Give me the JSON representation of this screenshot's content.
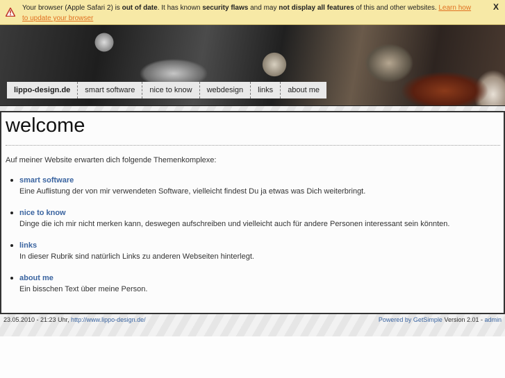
{
  "warning": {
    "text_1": "Your browser (Apple Safari 2) is ",
    "bold_1": "out of date",
    "text_2": ". It has known ",
    "bold_2": "security flaws",
    "text_3": " and may ",
    "bold_3": "not display all features",
    "text_4": " of this and other websites. ",
    "link": "Learn how to update your browser",
    "close_label": "X",
    "icon": "warning-triangle-icon"
  },
  "nav": {
    "items": [
      {
        "label": "lippo-design.de"
      },
      {
        "label": "smart software"
      },
      {
        "label": "nice to know"
      },
      {
        "label": "webdesign"
      },
      {
        "label": "links"
      },
      {
        "label": "about me"
      }
    ]
  },
  "content": {
    "title": "welcome",
    "intro": "Auf meiner Website erwarten dich folgende Themenkomplexe:",
    "topics": [
      {
        "link": "smart software",
        "desc": "Eine Auflistung der von mir verwendeten Software, vielleicht findest Du ja etwas was Dich weiterbringt."
      },
      {
        "link": "nice to know",
        "desc": "Dinge die ich mir nicht merken kann, deswegen aufschreiben und vielleicht auch für andere Personen interessant sein könnten."
      },
      {
        "link": "links",
        "desc": "In dieser Rubrik sind natürlich Links zu anderen Webseiten hinterlegt."
      },
      {
        "link": "about me",
        "desc": "Ein bisschen Text über meine Person."
      }
    ]
  },
  "footer": {
    "date": "23.05.2010 - 21:23 Uhr, ",
    "url": "http://www.lippo-design.de/",
    "powered": "Powered by GetSimple",
    "version": " Version 2.01 - ",
    "admin": "admin"
  }
}
